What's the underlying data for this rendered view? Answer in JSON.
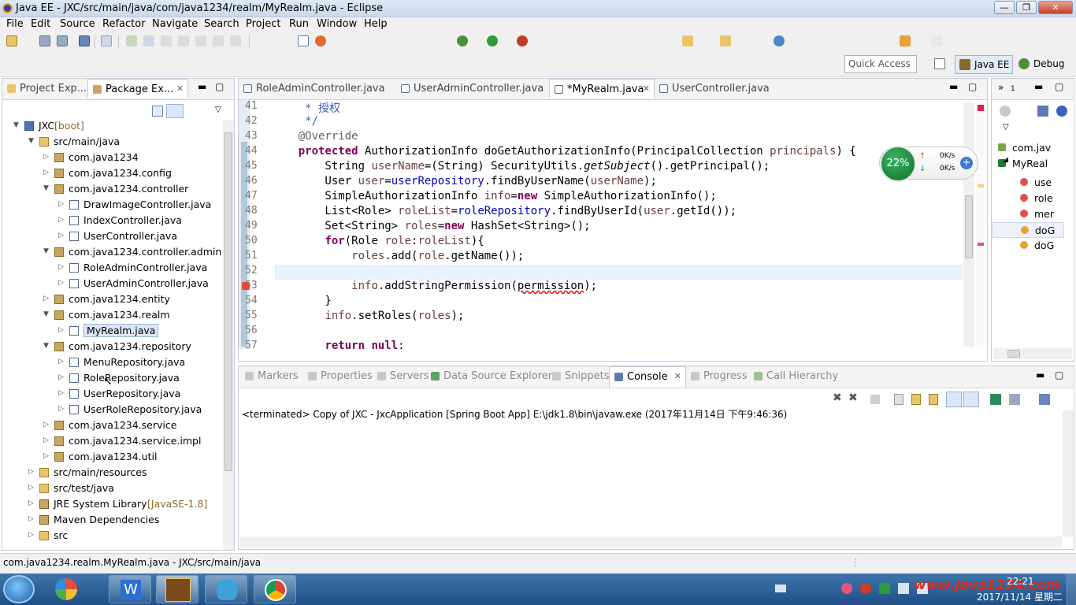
{
  "window": {
    "title": "Java EE - JXC/src/main/java/com/java1234/realm/MyRealm.java - Eclipse"
  },
  "menu": [
    "File",
    "Edit",
    "Source",
    "Refactor",
    "Navigate",
    "Search",
    "Project",
    "Run",
    "Window",
    "Help"
  ],
  "quick_access": "Quick Access",
  "perspectives": [
    "Java EE",
    "Debug"
  ],
  "left_tabs": [
    {
      "label": "Project Exp..."
    },
    {
      "label": "Package Ex..."
    }
  ],
  "tree": [
    {
      "label": "JXC",
      "suffix": " [boot]",
      "icon": "proj",
      "depth": 0,
      "arrow": "▼"
    },
    {
      "label": "src/main/java",
      "icon": "folder",
      "depth": 1,
      "arrow": "▼"
    },
    {
      "label": "com.java1234",
      "icon": "pkg",
      "depth": 2,
      "arrow": "▷"
    },
    {
      "label": "com.java1234.config",
      "icon": "pkg",
      "depth": 2,
      "arrow": "▷"
    },
    {
      "label": "com.java1234.controller",
      "icon": "pkg",
      "depth": 2,
      "arrow": "▼"
    },
    {
      "label": "DrawImageController.java",
      "icon": "jf",
      "depth": 3,
      "arrow": "▷"
    },
    {
      "label": "IndexController.java",
      "icon": "jf",
      "depth": 3,
      "arrow": "▷"
    },
    {
      "label": "UserController.java",
      "icon": "jf",
      "depth": 3,
      "arrow": "▷"
    },
    {
      "label": "com.java1234.controller.admin",
      "icon": "pkg",
      "depth": 2,
      "arrow": "▼"
    },
    {
      "label": "RoleAdminController.java",
      "icon": "jf",
      "depth": 3,
      "arrow": "▷"
    },
    {
      "label": "UserAdminController.java",
      "icon": "jf",
      "depth": 3,
      "arrow": "▷"
    },
    {
      "label": "com.java1234.entity",
      "icon": "pkg",
      "depth": 2,
      "arrow": "▷"
    },
    {
      "label": "com.java1234.realm",
      "icon": "pkg",
      "depth": 2,
      "arrow": "▼"
    },
    {
      "label": "MyRealm.java",
      "icon": "jf",
      "depth": 3,
      "arrow": "▷",
      "selected": true
    },
    {
      "label": "com.java1234.repository",
      "icon": "pkg",
      "depth": 2,
      "arrow": "▼"
    },
    {
      "label": "MenuRepository.java",
      "icon": "jf",
      "depth": 3,
      "arrow": "▷"
    },
    {
      "label": "RoleRepository.java",
      "icon": "jf",
      "depth": 3,
      "arrow": "▷",
      "hover": true
    },
    {
      "label": "UserRepository.java",
      "icon": "jf",
      "depth": 3,
      "arrow": "▷"
    },
    {
      "label": "UserRoleRepository.java",
      "icon": "jf",
      "depth": 3,
      "arrow": "▷"
    },
    {
      "label": "com.java1234.service",
      "icon": "pkg",
      "depth": 2,
      "arrow": "▷"
    },
    {
      "label": "com.java1234.service.impl",
      "icon": "pkg",
      "depth": 2,
      "arrow": "▷"
    },
    {
      "label": "com.java1234.util",
      "icon": "pkg",
      "depth": 2,
      "arrow": "▷"
    },
    {
      "label": "src/main/resources",
      "icon": "folder",
      "depth": 1,
      "arrow": "▷"
    },
    {
      "label": "src/test/java",
      "icon": "folder",
      "depth": 1,
      "arrow": "▷"
    },
    {
      "label": "JRE System Library",
      "suffix": " [JavaSE-1.8]",
      "icon": "jar",
      "depth": 1,
      "arrow": "▷"
    },
    {
      "label": "Maven Dependencies",
      "icon": "jar",
      "depth": 1,
      "arrow": "▷"
    },
    {
      "label": "src",
      "icon": "folder",
      "depth": 1,
      "arrow": "▷"
    }
  ],
  "editor_tabs": [
    {
      "label": "RoleAdminController.java",
      "active": false
    },
    {
      "label": "UserAdminController.java",
      "active": false
    },
    {
      "label": "*MyRealm.java",
      "active": true
    },
    {
      "label": "UserController.java",
      "active": false
    }
  ],
  "code_lines": [
    {
      "n": "41",
      "html": "     <span class=\"cm\">* 授权</span>"
    },
    {
      "n": "42",
      "html": "     <span class=\"cm\">*/</span>"
    },
    {
      "n": "43",
      "html": "    <span class=\"an\">@Override</span>"
    },
    {
      "n": "44",
      "html": "    <span class=\"kw\">protected</span> AuthorizationInfo doGetAuthorizationInfo(PrincipalCollection <span class=\"vr\">principals</span>) {"
    },
    {
      "n": "45",
      "html": "        String <span class=\"vr\">userName</span>=(String) SecurityUtils.<span class=\"it\">getSubject</span>().getPrincipal();"
    },
    {
      "n": "46",
      "html": "        User <span class=\"vr\">user</span>=<span class=\"fd\">userRepository</span>.findByUserName(<span class=\"vr\">userName</span>);"
    },
    {
      "n": "47",
      "html": "        SimpleAuthorizationInfo <span class=\"vr\">info</span>=<span class=\"kw\">new</span> SimpleAuthorizationInfo();"
    },
    {
      "n": "48",
      "html": "        List&lt;Role&gt; <span class=\"vr\">roleList</span>=<span class=\"fd\">roleRepository</span>.findByUserId(<span class=\"vr\">user</span>.getId());"
    },
    {
      "n": "49",
      "html": "        Set&lt;String&gt; <span class=\"vr\">roles</span>=<span class=\"kw\">new</span> HashSet&lt;String&gt;();"
    },
    {
      "n": "50",
      "html": "        <span class=\"kw\">for</span>(Role <span class=\"vr\">role</span>:<span class=\"vr\">roleList</span>){"
    },
    {
      "n": "51",
      "html": "            <span class=\"vr\">roles</span>.add(<span class=\"vr\">role</span>.getName());"
    },
    {
      "n": "52",
      "html": ""
    },
    {
      "n": "53",
      "html": "            <span class=\"vr\">info</span>.addStringPermission(<span style=\"text-decoration:underline wavy #e00\">permission</span>);"
    },
    {
      "n": "54",
      "html": "        }"
    },
    {
      "n": "55",
      "html": "        <span class=\"vr\">info</span>.setRoles(<span class=\"vr\">roles</span>);"
    },
    {
      "n": "56",
      "html": ""
    },
    {
      "n": "57",
      "html": "        <span class=\"kw\">return null</span>;"
    }
  ],
  "widget": {
    "percent": "22%",
    "up": "0K/s",
    "down": "0K/s"
  },
  "outline_items": [
    "com.jav",
    "MyReal",
    "use",
    "role",
    "mer",
    "doG",
    "doG"
  ],
  "bottom_tabs": [
    {
      "label": "Markers",
      "active": false
    },
    {
      "label": "Properties",
      "active": false
    },
    {
      "label": "Servers",
      "active": false
    },
    {
      "label": "Data Source Explorer",
      "active": false
    },
    {
      "label": "Snippets",
      "active": false
    },
    {
      "label": "Console",
      "active": true
    },
    {
      "label": "Progress",
      "active": false
    },
    {
      "label": "Call Hierarchy",
      "active": false
    }
  ],
  "console_text": "<terminated> Copy of JXC - JxcApplication [Spring Boot App] E:\\jdk1.8\\bin\\javaw.exe (2017年11月14日 下午9:46:36)",
  "status_text": "com.java1234.realm.MyRealm.java - JXC/src/main/java",
  "taskbar": {
    "time": "22:21",
    "date": "2017/11/14 星期二",
    "watermark": "www.java1234.com"
  },
  "colors": {
    "accent": "#3c6cb4",
    "keyword": "#7f0055",
    "field": "#0000c0",
    "widget": "#1a8f3a"
  }
}
